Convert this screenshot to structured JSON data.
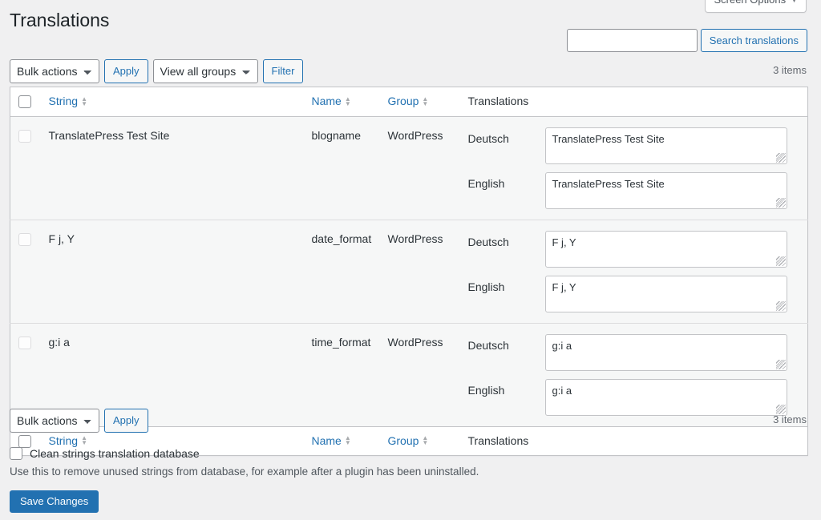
{
  "screen_options": {
    "label": "Screen Options",
    "caret": "chevron-down-icon"
  },
  "header": {
    "title": "Translations"
  },
  "search": {
    "value": "",
    "placeholder": "",
    "button_label": "Search translations"
  },
  "tablenav_top": {
    "bulk_actions_label": "Bulk actions",
    "bulk_actions_options": [
      "Bulk actions"
    ],
    "apply_label": "Apply",
    "view_groups_label": "View all groups",
    "view_groups_options": [
      "View all groups"
    ],
    "filter_label": "Filter",
    "displaying_num": "3 items"
  },
  "tablenav_bottom": {
    "bulk_actions_label": "Bulk actions",
    "bulk_actions_options": [
      "Bulk actions"
    ],
    "apply_label": "Apply",
    "displaying_num": "3 items"
  },
  "table": {
    "columns": {
      "string": "String",
      "name": "Name",
      "group": "Group",
      "translations": "Translations"
    },
    "rows": [
      {
        "string": "TranslatePress Test Site",
        "name": "blogname",
        "group": "WordPress",
        "translations": [
          {
            "language": "Deutsch",
            "value": "TranslatePress Test Site"
          },
          {
            "language": "English",
            "value": "TranslatePress Test Site"
          }
        ]
      },
      {
        "string": "F j, Y",
        "name": "date_format",
        "group": "WordPress",
        "translations": [
          {
            "language": "Deutsch",
            "value": "F j, Y"
          },
          {
            "language": "English",
            "value": "F j, Y"
          }
        ]
      },
      {
        "string": "g:i a",
        "name": "time_format",
        "group": "WordPress",
        "translations": [
          {
            "language": "Deutsch",
            "value": "g:i a"
          },
          {
            "language": "English",
            "value": "g:i a"
          }
        ]
      }
    ]
  },
  "clean_db": {
    "label": "Clean strings translation database",
    "description": "Use this to remove unused strings from database, for example after a plugin has been uninstalled.",
    "checked": false
  },
  "save_button": {
    "label": "Save Changes"
  },
  "colors": {
    "accent": "#2271b1",
    "page_bg": "#f0f0f1",
    "row_bg": "#f6f7f7",
    "border": "#c3c4c7",
    "text": "#2c3338"
  }
}
